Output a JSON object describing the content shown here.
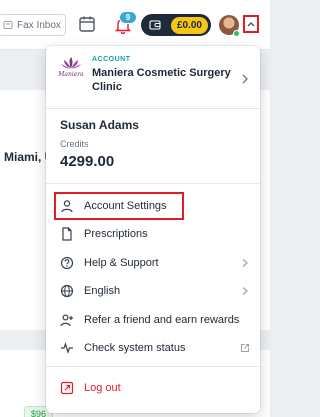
{
  "topbar": {
    "fax_label": "Fax Inbox",
    "notification_count": "9",
    "wallet_amount": "£0.00"
  },
  "background": {
    "location_text": "Miami, U",
    "price_badge": "$96"
  },
  "dropdown": {
    "account_label": "ACCOUNT",
    "account_name": "Maniera Cosmetic Surgery Clinic",
    "logo_text": "Maniera",
    "user_name": "Susan Adams",
    "credits_label": "Credits",
    "credits_value": "4299.00",
    "menu": [
      {
        "label": "Account Settings",
        "icon": "user-icon"
      },
      {
        "label": "Prescriptions",
        "icon": "document-icon"
      },
      {
        "label": "Help & Support",
        "icon": "help-icon"
      },
      {
        "label": "English",
        "icon": "globe-icon"
      },
      {
        "label": "Refer a friend and earn rewards",
        "icon": "user-plus-icon"
      },
      {
        "label": "Check system status",
        "icon": "activity-icon"
      },
      {
        "label": "Log out",
        "icon": "logout-icon"
      }
    ]
  },
  "colors": {
    "accent_teal": "#0ea5a4",
    "danger_red": "#e11d2a",
    "wallet_dark": "#1e2a3a",
    "wallet_yellow": "#f5c518",
    "badge_blue": "#38a8d6"
  }
}
